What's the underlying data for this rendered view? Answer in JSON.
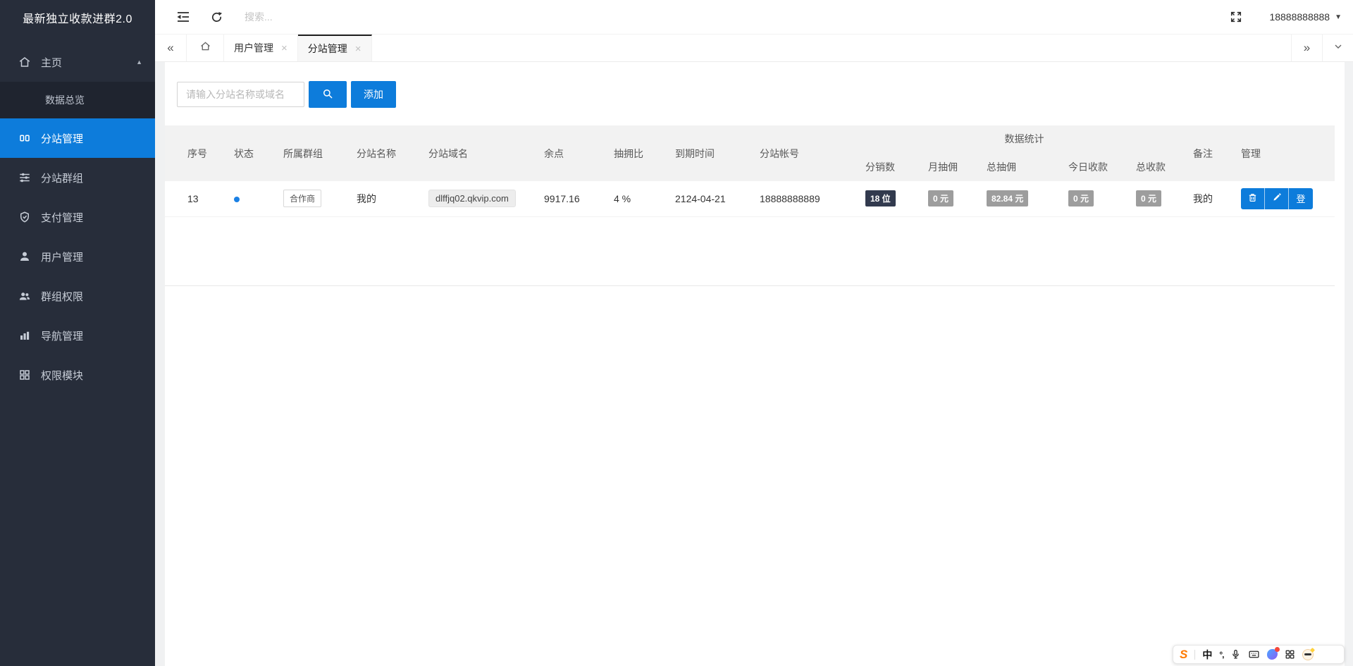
{
  "app": {
    "title": "最新独立收款进群2.0"
  },
  "topbar": {
    "search_placeholder": "搜索...",
    "account": "18888888888"
  },
  "sidebar": {
    "items": [
      {
        "label": "主页"
      },
      {
        "label": "数据总览"
      },
      {
        "label": "分站管理"
      },
      {
        "label": "分站群组"
      },
      {
        "label": "支付管理"
      },
      {
        "label": "用户管理"
      },
      {
        "label": "群组权限"
      },
      {
        "label": "导航管理"
      },
      {
        "label": "权限模块"
      }
    ]
  },
  "tabs": {
    "close_glyph": "×",
    "items": [
      {
        "label": "用户管理"
      },
      {
        "label": "分站管理"
      }
    ]
  },
  "glyphs": {
    "scroll_left": "«",
    "scroll_right": "»",
    "caret_down": "▼",
    "caret_up": "▲"
  },
  "toolbar": {
    "search_placeholder": "请输入分站名称或域名",
    "add_label": "添加"
  },
  "table": {
    "group_header": "数据统计",
    "columns": [
      "序号",
      "状态",
      "所属群组",
      "分站名称",
      "分站域名",
      "余点",
      "抽拥比",
      "到期时间",
      "分站帐号"
    ],
    "stat_columns": [
      "分销数",
      "月抽佣",
      "总抽佣",
      "今日收款",
      "总收款"
    ],
    "tail_columns": [
      "备注",
      "管理"
    ],
    "row": {
      "index": "13",
      "group": "合作商",
      "site_name": "我的",
      "domain": "dlffjq02.qkvip.com",
      "balance": "9917.16",
      "commission_rate": "4 %",
      "expire_date": "2124-04-21",
      "account": "18888888889",
      "distributors": "18 位",
      "month_commission": "0 元",
      "total_commission": "82.84 元",
      "today_income": "0 元",
      "total_income": "0 元",
      "remark": "我的",
      "login_label": "登"
    }
  },
  "ime": {
    "logo": "S",
    "mode": "中",
    "punct": "°,"
  },
  "colors": {
    "accent": "#0d7cdb",
    "sidebar_bg": "#272d3a",
    "sidebar_submenu_bg": "#1f242f",
    "badge_dark_bg": "#323a4e",
    "badge_gray_bg": "#9d9d9d",
    "status_dot": "#1b80e4",
    "ime_orange": "#ff7a00"
  }
}
